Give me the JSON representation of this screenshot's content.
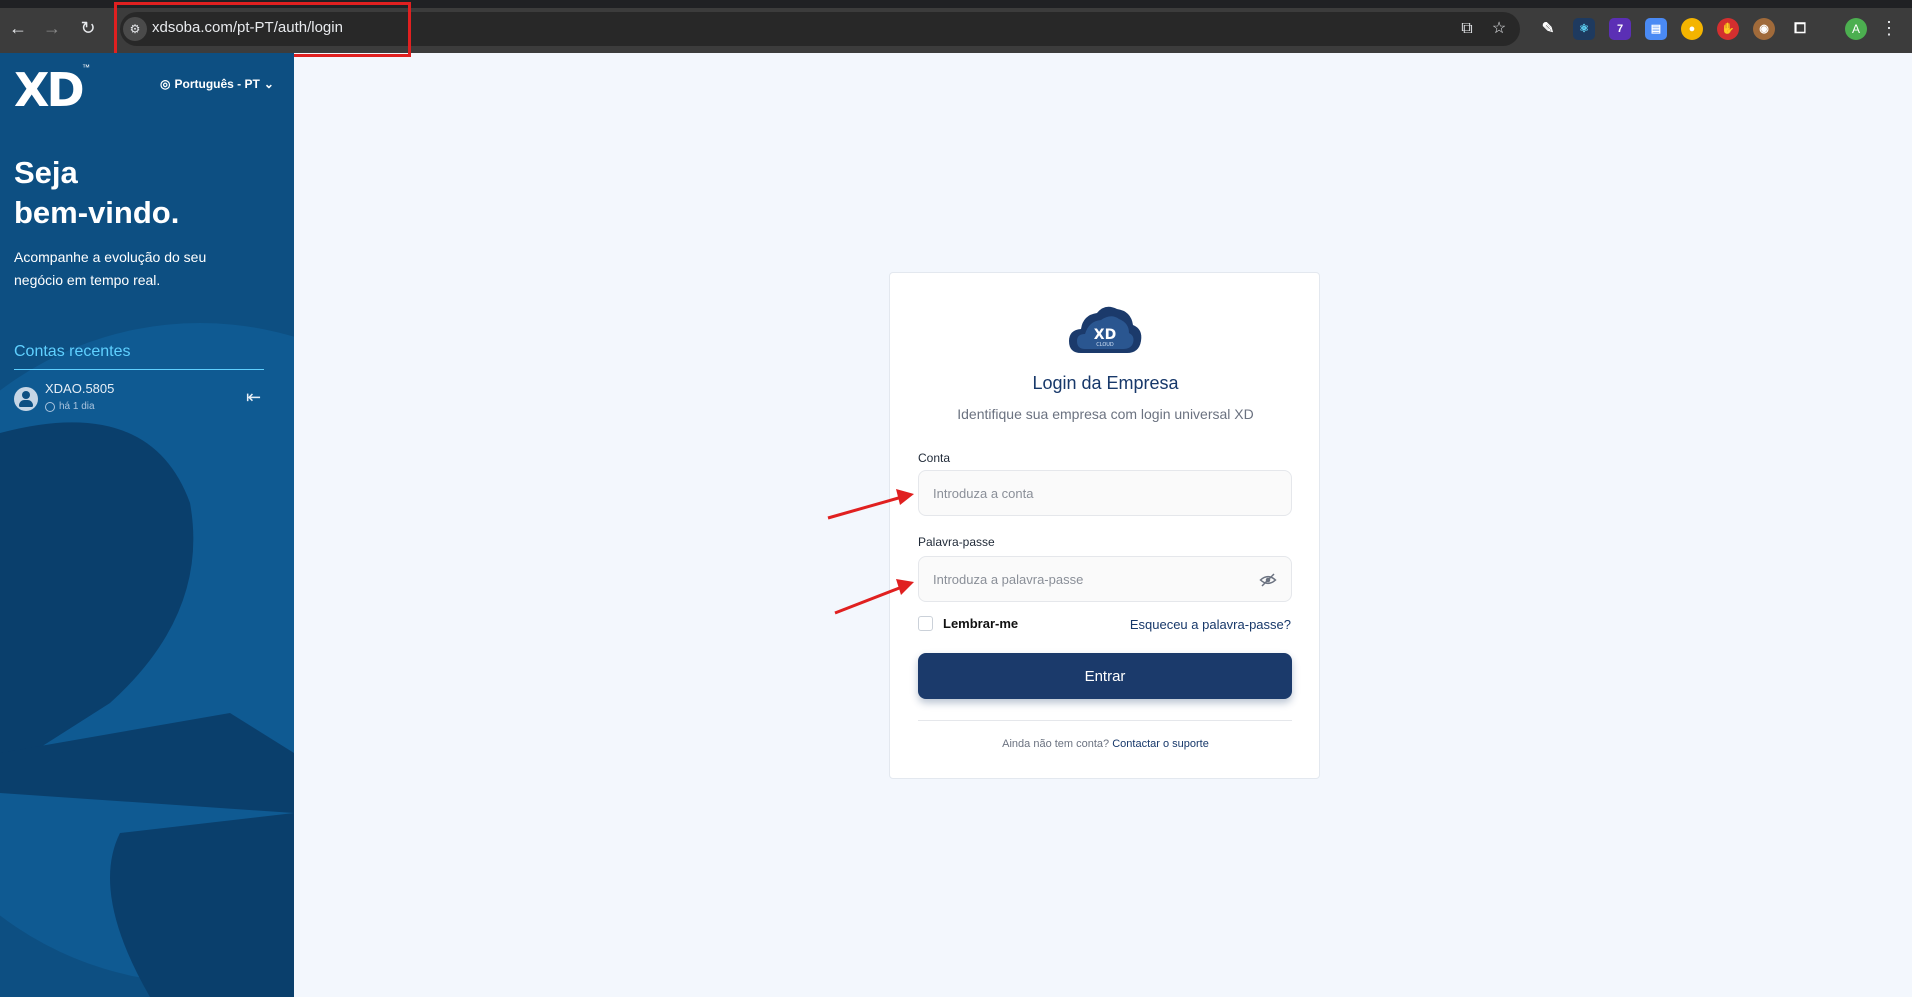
{
  "browser": {
    "url": "xdsoba.com/pt-PT/auth/login",
    "profile_initial": "A",
    "extension_badge": "7"
  },
  "sidebar": {
    "logo_text": "XD",
    "trademark": "™",
    "language": "Português - PT",
    "welcome_line1": "Seja",
    "welcome_line2": "bem-vindo.",
    "tagline": "Acompanhe a evolução do seu negócio em tempo real.",
    "recent_title": "Contas recentes",
    "recent_accounts": [
      {
        "name": "XDAO.5805",
        "time": "há 1 dia"
      }
    ]
  },
  "card": {
    "logo_text": "XD",
    "logo_subtext": "CLOUD",
    "title": "Login da Empresa",
    "subtitle": "Identifique sua empresa com login universal XD",
    "account_label": "Conta",
    "account_placeholder": "Introduza a conta",
    "password_label": "Palavra-passe",
    "password_placeholder": "Introduza a palavra-passe",
    "remember_label": "Lembrar-me",
    "forgot_label": "Esqueceu a palavra-passe?",
    "submit_label": "Entrar",
    "no_account_text": "Ainda não tem conta?",
    "support_link": "Contactar o suporte"
  },
  "colors": {
    "sidebar_bg": "#0d4f82",
    "accent_cyan": "#5fd0ff",
    "primary_button": "#1b3a6b",
    "annotation_red": "#e02020",
    "page_bg": "#f3f7fd"
  }
}
